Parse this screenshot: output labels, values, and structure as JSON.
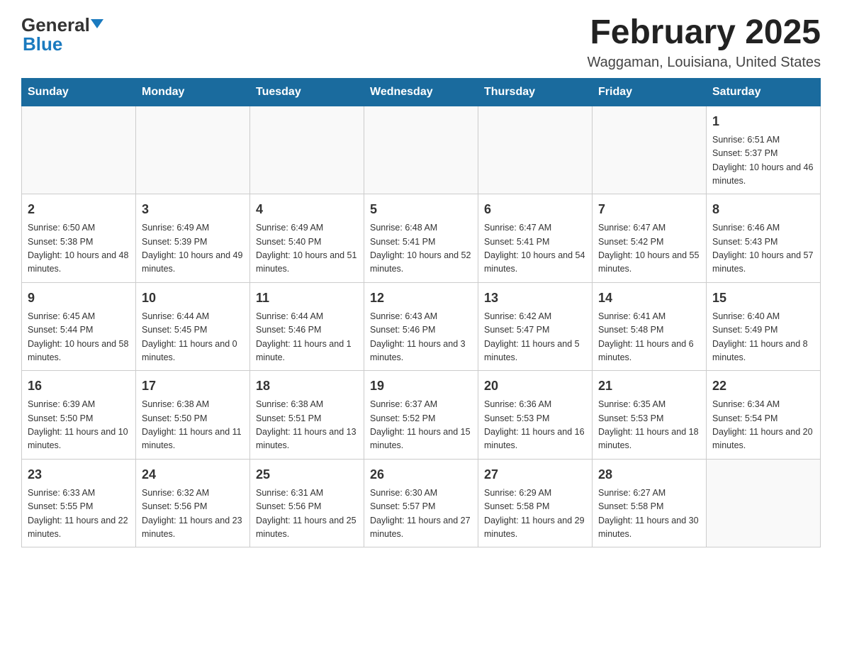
{
  "header": {
    "logo_general": "General",
    "logo_blue": "Blue",
    "month_title": "February 2025",
    "location": "Waggaman, Louisiana, United States"
  },
  "days_of_week": [
    "Sunday",
    "Monday",
    "Tuesday",
    "Wednesday",
    "Thursday",
    "Friday",
    "Saturday"
  ],
  "weeks": [
    [
      {
        "day": "",
        "info": ""
      },
      {
        "day": "",
        "info": ""
      },
      {
        "day": "",
        "info": ""
      },
      {
        "day": "",
        "info": ""
      },
      {
        "day": "",
        "info": ""
      },
      {
        "day": "",
        "info": ""
      },
      {
        "day": "1",
        "info": "Sunrise: 6:51 AM\nSunset: 5:37 PM\nDaylight: 10 hours and 46 minutes."
      }
    ],
    [
      {
        "day": "2",
        "info": "Sunrise: 6:50 AM\nSunset: 5:38 PM\nDaylight: 10 hours and 48 minutes."
      },
      {
        "day": "3",
        "info": "Sunrise: 6:49 AM\nSunset: 5:39 PM\nDaylight: 10 hours and 49 minutes."
      },
      {
        "day": "4",
        "info": "Sunrise: 6:49 AM\nSunset: 5:40 PM\nDaylight: 10 hours and 51 minutes."
      },
      {
        "day": "5",
        "info": "Sunrise: 6:48 AM\nSunset: 5:41 PM\nDaylight: 10 hours and 52 minutes."
      },
      {
        "day": "6",
        "info": "Sunrise: 6:47 AM\nSunset: 5:41 PM\nDaylight: 10 hours and 54 minutes."
      },
      {
        "day": "7",
        "info": "Sunrise: 6:47 AM\nSunset: 5:42 PM\nDaylight: 10 hours and 55 minutes."
      },
      {
        "day": "8",
        "info": "Sunrise: 6:46 AM\nSunset: 5:43 PM\nDaylight: 10 hours and 57 minutes."
      }
    ],
    [
      {
        "day": "9",
        "info": "Sunrise: 6:45 AM\nSunset: 5:44 PM\nDaylight: 10 hours and 58 minutes."
      },
      {
        "day": "10",
        "info": "Sunrise: 6:44 AM\nSunset: 5:45 PM\nDaylight: 11 hours and 0 minutes."
      },
      {
        "day": "11",
        "info": "Sunrise: 6:44 AM\nSunset: 5:46 PM\nDaylight: 11 hours and 1 minute."
      },
      {
        "day": "12",
        "info": "Sunrise: 6:43 AM\nSunset: 5:46 PM\nDaylight: 11 hours and 3 minutes."
      },
      {
        "day": "13",
        "info": "Sunrise: 6:42 AM\nSunset: 5:47 PM\nDaylight: 11 hours and 5 minutes."
      },
      {
        "day": "14",
        "info": "Sunrise: 6:41 AM\nSunset: 5:48 PM\nDaylight: 11 hours and 6 minutes."
      },
      {
        "day": "15",
        "info": "Sunrise: 6:40 AM\nSunset: 5:49 PM\nDaylight: 11 hours and 8 minutes."
      }
    ],
    [
      {
        "day": "16",
        "info": "Sunrise: 6:39 AM\nSunset: 5:50 PM\nDaylight: 11 hours and 10 minutes."
      },
      {
        "day": "17",
        "info": "Sunrise: 6:38 AM\nSunset: 5:50 PM\nDaylight: 11 hours and 11 minutes."
      },
      {
        "day": "18",
        "info": "Sunrise: 6:38 AM\nSunset: 5:51 PM\nDaylight: 11 hours and 13 minutes."
      },
      {
        "day": "19",
        "info": "Sunrise: 6:37 AM\nSunset: 5:52 PM\nDaylight: 11 hours and 15 minutes."
      },
      {
        "day": "20",
        "info": "Sunrise: 6:36 AM\nSunset: 5:53 PM\nDaylight: 11 hours and 16 minutes."
      },
      {
        "day": "21",
        "info": "Sunrise: 6:35 AM\nSunset: 5:53 PM\nDaylight: 11 hours and 18 minutes."
      },
      {
        "day": "22",
        "info": "Sunrise: 6:34 AM\nSunset: 5:54 PM\nDaylight: 11 hours and 20 minutes."
      }
    ],
    [
      {
        "day": "23",
        "info": "Sunrise: 6:33 AM\nSunset: 5:55 PM\nDaylight: 11 hours and 22 minutes."
      },
      {
        "day": "24",
        "info": "Sunrise: 6:32 AM\nSunset: 5:56 PM\nDaylight: 11 hours and 23 minutes."
      },
      {
        "day": "25",
        "info": "Sunrise: 6:31 AM\nSunset: 5:56 PM\nDaylight: 11 hours and 25 minutes."
      },
      {
        "day": "26",
        "info": "Sunrise: 6:30 AM\nSunset: 5:57 PM\nDaylight: 11 hours and 27 minutes."
      },
      {
        "day": "27",
        "info": "Sunrise: 6:29 AM\nSunset: 5:58 PM\nDaylight: 11 hours and 29 minutes."
      },
      {
        "day": "28",
        "info": "Sunrise: 6:27 AM\nSunset: 5:58 PM\nDaylight: 11 hours and 30 minutes."
      },
      {
        "day": "",
        "info": ""
      }
    ]
  ]
}
